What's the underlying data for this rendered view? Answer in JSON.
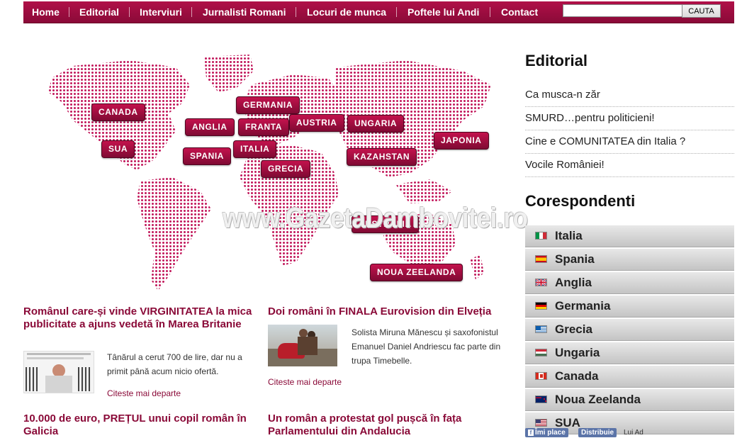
{
  "nav": {
    "items": [
      "Home",
      "Editorial",
      "Interviuri",
      "Jurnalisti Romani",
      "Locuri de munca",
      "Poftele lui Andi",
      "Contact"
    ],
    "search_value": "",
    "search_button": "CAUTA"
  },
  "map": {
    "countries": [
      "CANADA",
      "SUA",
      "ANGLIA",
      "FRANTA",
      "GERMANIA",
      "AUSTRIA",
      "UNGARIA",
      "SPANIA",
      "ITALIA",
      "GRECIA",
      "KAZAHSTAN",
      "JAPONIA",
      "AUSTRALIA",
      "NOUA ZEELANDA"
    ],
    "watermark": "www.GazetaDambovitei.ro",
    "dot_color": "#c2185b"
  },
  "articles": [
    {
      "title": "Românul care-și vinde VIRGINITATEA la mica publicitate a ajuns vedetă în Marea Britanie",
      "excerpt": "Tânărul a cerut 700 de lire, dar nu a primit până acum nicio ofertă.",
      "read_more": "Citeste mai departe"
    },
    {
      "title": "Doi români în FINALA Eurovision din Elveția",
      "excerpt": "Solista Miruna Mănescu și saxofonistul Emanuel Daniel Andriescu fac parte din trupa Timebelle.",
      "read_more": "Citeste mai departe"
    },
    {
      "title": "10.000 de euro, PREȚUL unui copil român în Galicia"
    },
    {
      "title": "Un român a protestat gol pușcă în fața Parlamentului din Andalucia"
    }
  ],
  "sidebar": {
    "editorial_heading": "Editorial",
    "editorial_items": [
      "Ca musca-n zăr",
      "SMURD…pentru politicieni!",
      "Cine e COMUNITATEA din Italia ?",
      "Vocile României!"
    ],
    "correspondents_heading": "Corespondenti",
    "correspondents": [
      "Italia",
      "Spania",
      "Anglia",
      "Germania",
      "Grecia",
      "Ungaria",
      "Canada",
      "Noua Zeelanda",
      "SUA"
    ]
  },
  "facebook": {
    "like": "Îmi place",
    "share": "Distribuie",
    "text": "Lui Ad"
  },
  "colors": {
    "brand": "#8a0a38",
    "accent": "#c3124d"
  }
}
